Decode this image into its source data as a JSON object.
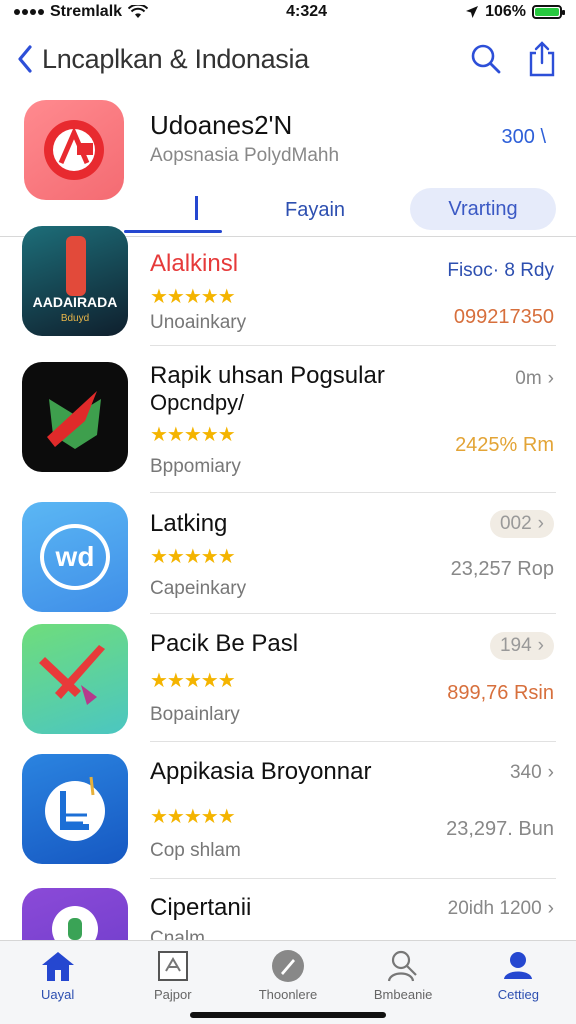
{
  "status": {
    "carrier": "Stremlalk",
    "time": "4:324",
    "battery": "106%"
  },
  "nav": {
    "title": "Lncaplkan & Indonasia"
  },
  "featured": {
    "title": "Udoanes2'N",
    "subtitle": "Aopsnasia PolydMahh",
    "price": "300 \\"
  },
  "tabs": {
    "tab1": "Fayain",
    "tab2": "Vrarting"
  },
  "apps": [
    {
      "name": "Alalkinsl",
      "stars": "★★★★★",
      "category": "Unoainkary",
      "right_top": "Fisoc· 8 Rdy",
      "right_bottom": "099217350",
      "icon_text": "AADAIRADA",
      "icon_subtext": "Bduyd"
    },
    {
      "name": "Rapik uhsan Pogsular",
      "subline": "Opcndpy/",
      "stars": "★★★★★",
      "category": "Bppomiary",
      "right_top": "0m",
      "right_bottom": "2425% Rm"
    },
    {
      "name": "Latking",
      "stars": "★★★★★",
      "category": "Capeinkary",
      "right_top": "002",
      "right_bottom": "23,257 Rop",
      "icon_text": "wd"
    },
    {
      "name": "Pacik Be Pasl",
      "stars": "★★★★★",
      "category": "Bopainlary",
      "right_top": "194",
      "right_bottom": "899,76 Rsin"
    },
    {
      "name": "Appikasia Broyonnar",
      "stars": "★★★★★",
      "category": "Cop shlam",
      "right_top": "340",
      "right_bottom": "23,297. Bun"
    },
    {
      "name": "Cipertanii",
      "category": "Cnalm",
      "right_top": "20idh 1200"
    }
  ],
  "tabbar": {
    "items": [
      "Uayal",
      "Pajpor",
      "Thoonlere",
      "Bmbeanie",
      "Cettieg"
    ]
  },
  "colors": {
    "accent": "#2d4fb0",
    "star": "#f4b400",
    "price_red": "#d76f3c"
  }
}
